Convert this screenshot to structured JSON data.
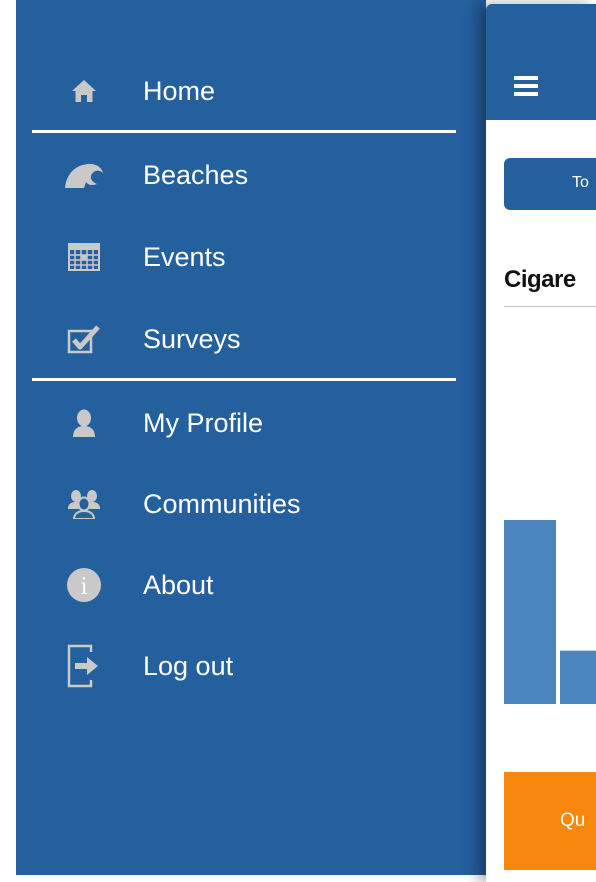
{
  "menu": {
    "items": [
      {
        "label": "Home",
        "icon": "home-icon"
      },
      {
        "label": "Beaches",
        "icon": "wave-icon"
      },
      {
        "label": "Events",
        "icon": "calendar-icon"
      },
      {
        "label": "Surveys",
        "icon": "checkbox-icon"
      },
      {
        "label": "My Profile",
        "icon": "user-icon"
      },
      {
        "label": "Communities",
        "icon": "group-icon"
      },
      {
        "label": "About",
        "icon": "info-icon"
      },
      {
        "label": "Log out",
        "icon": "logout-icon"
      }
    ]
  },
  "main": {
    "tab_label": "To",
    "section_title": "Cigare",
    "action_label": "Qu"
  },
  "chart_data": {
    "type": "bar",
    "categories": [
      "",
      ""
    ],
    "values": [
      100,
      29
    ],
    "title": "",
    "xlabel": "",
    "ylabel": ""
  },
  "colors": {
    "sidebar": "#245f9e",
    "bar": "#4a86bd",
    "action": "#f7870d",
    "icon": "#c9c9c9"
  }
}
